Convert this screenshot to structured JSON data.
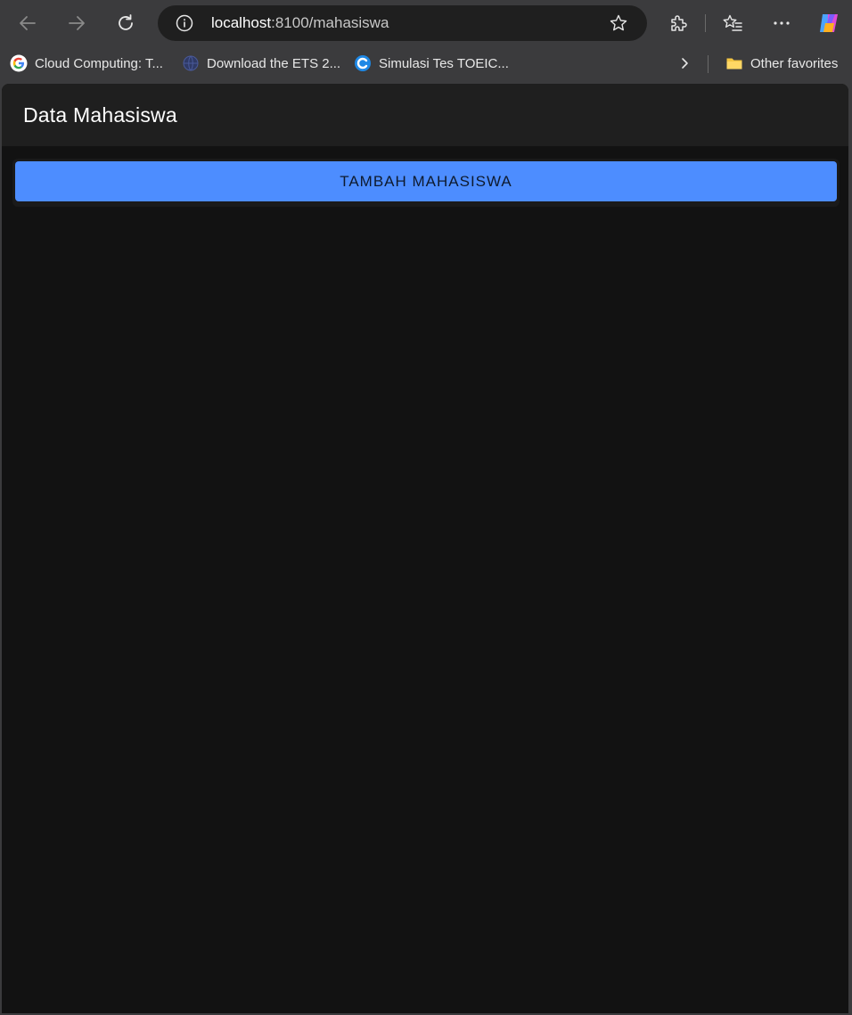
{
  "browser": {
    "address": {
      "host": "localhost",
      "path": ":8100/mahasiswa"
    },
    "bookmarks": [
      {
        "label": "Cloud Computing: T...",
        "icon": "google-icon"
      },
      {
        "label": "Download the ETS 2...",
        "icon": "globe-icon"
      },
      {
        "label": "Simulasi Tes TOEIC...",
        "icon": "c-logo-icon"
      }
    ],
    "other_favorites": "Other favorites"
  },
  "app": {
    "title": "Data Mahasiswa",
    "add_button_label": "TAMBAH MAHASISWA",
    "accent_color": "#4d8dff",
    "background_color": "#121212",
    "header_color": "#1f1f1f"
  }
}
